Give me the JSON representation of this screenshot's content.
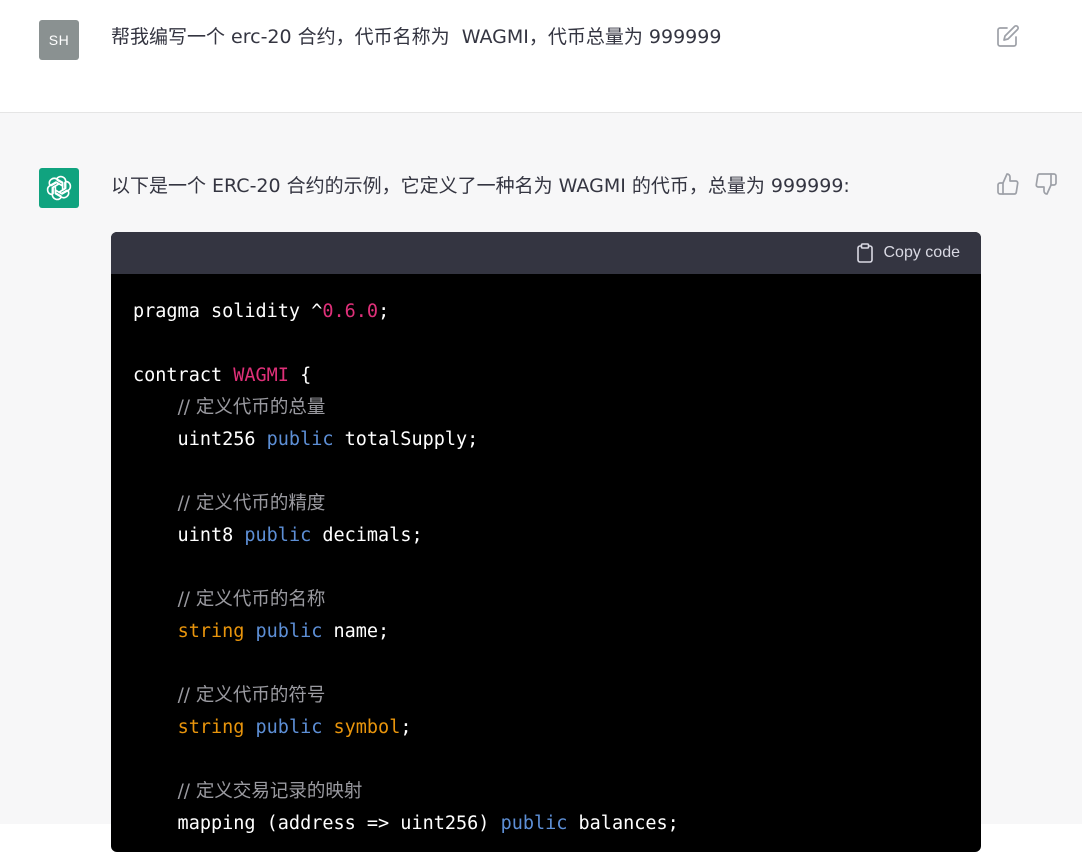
{
  "user_message": {
    "avatar_initials": "SH",
    "text": "帮我编写一个 erc-20 合约，代币名称为  WAGMI，代币总量为 999999"
  },
  "assistant_message": {
    "text": "以下是一个 ERC-20 合约的示例，它定义了一种名为 WAGMI 的代币，总量为 999999:",
    "code_block": {
      "copy_label": "Copy code",
      "lines": [
        [
          {
            "t": "pragma solidity ^",
            "c": "plain"
          },
          {
            "t": "0.6.0",
            "c": "num"
          },
          {
            "t": ";",
            "c": "plain"
          }
        ],
        [],
        [
          {
            "t": "contract ",
            "c": "plain"
          },
          {
            "t": "WAGMI",
            "c": "name"
          },
          {
            "t": " {",
            "c": "plain"
          }
        ],
        [
          {
            "t": "    ",
            "c": "plain"
          },
          {
            "t": "// 定义代币的总量",
            "c": "comment"
          }
        ],
        [
          {
            "t": "    uint256 ",
            "c": "plain"
          },
          {
            "t": "public",
            "c": "kw"
          },
          {
            "t": " totalSupply;",
            "c": "plain"
          }
        ],
        [],
        [
          {
            "t": "    ",
            "c": "plain"
          },
          {
            "t": "// 定义代币的精度",
            "c": "comment"
          }
        ],
        [
          {
            "t": "    uint8 ",
            "c": "plain"
          },
          {
            "t": "public",
            "c": "kw"
          },
          {
            "t": " decimals;",
            "c": "plain"
          }
        ],
        [],
        [
          {
            "t": "    ",
            "c": "plain"
          },
          {
            "t": "// 定义代币的名称",
            "c": "comment"
          }
        ],
        [
          {
            "t": "    ",
            "c": "plain"
          },
          {
            "t": "string",
            "c": "type"
          },
          {
            "t": " ",
            "c": "plain"
          },
          {
            "t": "public",
            "c": "kw"
          },
          {
            "t": " name;",
            "c": "plain"
          }
        ],
        [],
        [
          {
            "t": "    ",
            "c": "plain"
          },
          {
            "t": "// 定义代币的符号",
            "c": "comment"
          }
        ],
        [
          {
            "t": "    ",
            "c": "plain"
          },
          {
            "t": "string",
            "c": "type"
          },
          {
            "t": " ",
            "c": "plain"
          },
          {
            "t": "public",
            "c": "kw"
          },
          {
            "t": " ",
            "c": "plain"
          },
          {
            "t": "symbol",
            "c": "type"
          },
          {
            "t": ";",
            "c": "plain"
          }
        ],
        [],
        [
          {
            "t": "    ",
            "c": "plain"
          },
          {
            "t": "// 定义交易记录的映射",
            "c": "comment"
          }
        ],
        [
          {
            "t": "    mapping (address => uint256) ",
            "c": "plain"
          },
          {
            "t": "public",
            "c": "kw"
          },
          {
            "t": " balances;",
            "c": "plain"
          }
        ]
      ]
    }
  },
  "icons": {
    "edit": "edit-icon",
    "thumbs_up": "thumbs-up-icon",
    "thumbs_down": "thumbs-down-icon",
    "clipboard": "clipboard-icon",
    "assistant_logo": "openai-logo-icon"
  },
  "colors": {
    "user_avatar_bg": "#8a9191",
    "assistant_avatar_bg": "#10a37f",
    "code_header_bg": "#343541",
    "code_bg": "#000000",
    "keyword": "#5d8fd6",
    "type": "#e9950c",
    "number": "#df3079",
    "comment": "#9a9aa0"
  }
}
